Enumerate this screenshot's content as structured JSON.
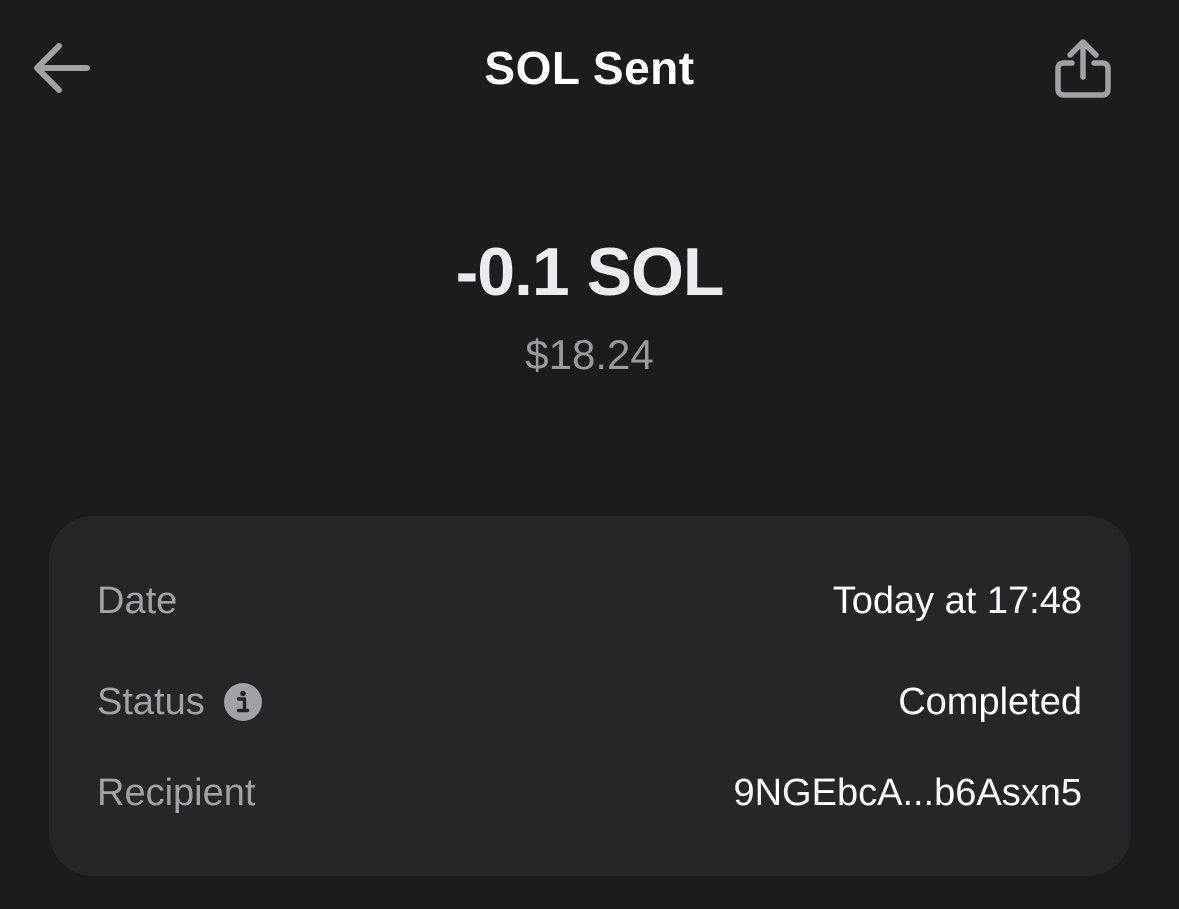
{
  "header": {
    "title": "SOL Sent",
    "back_icon": "arrow-left-icon",
    "share_icon": "share-icon"
  },
  "summary": {
    "amount": "-0.1 SOL",
    "fiat_value": "$18.24"
  },
  "details": {
    "rows": [
      {
        "label": "Date",
        "value": "Today at 17:48"
      },
      {
        "label": "Status",
        "value": "Completed",
        "icon": "info-icon"
      },
      {
        "label": "Recipient",
        "value": "9NGEbcA...b6Asxn5"
      }
    ]
  },
  "colors": {
    "background": "#1c1c1d",
    "card": "#262628",
    "primary_text": "#ffffff",
    "secondary_text": "#a1a1a6"
  }
}
